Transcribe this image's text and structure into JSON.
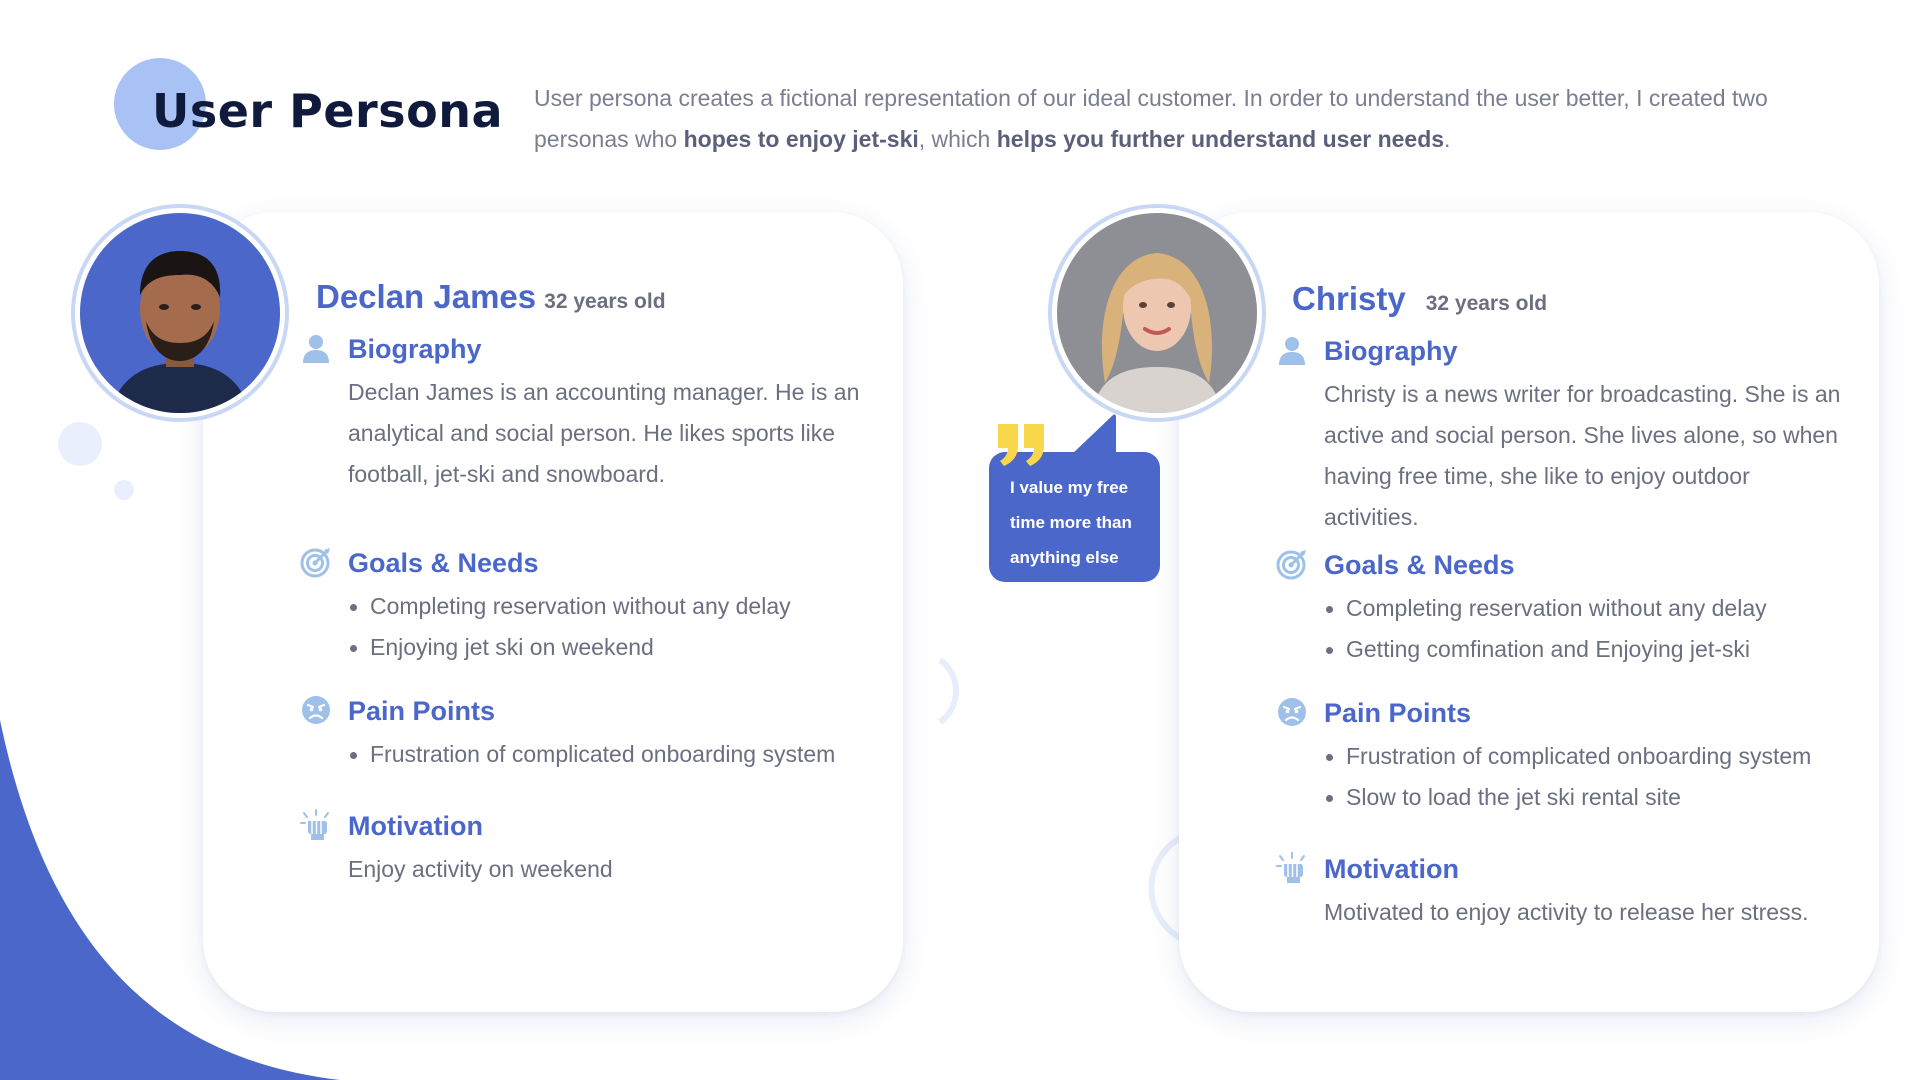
{
  "header": {
    "title": "User Persona",
    "intro_1": "User persona creates a fictional representation of our ideal customer. In order to understand the user better, I created two personas who ",
    "intro_bold_1": "hopes to enjoy jet-ski",
    "intro_2": ", which ",
    "intro_bold_2": "helps you further understand user needs",
    "intro_3": "."
  },
  "personas": [
    {
      "name": "Declan James",
      "age": "32 years old",
      "biography_title": "Biography",
      "biography": "Declan James is an accounting manager. He is an analytical and social person. He likes sports like football, jet-ski and snowboard.",
      "goals_title": "Goals & Needs",
      "goals": [
        "Completing reservation without any delay",
        "Enjoying jet ski on weekend"
      ],
      "pain_title": "Pain Points",
      "pain": [
        "Frustration of complicated onboarding system"
      ],
      "motivation_title": "Motivation",
      "motivation": "Enjoy activity on weekend"
    },
    {
      "name": "Christy",
      "age": "32 years old",
      "biography_title": "Biography",
      "biography": "Christy is a news writer for broadcasting. She is an active and social person. She lives alone, so when having free time, she like to enjoy outdoor activities.",
      "goals_title": "Goals & Needs",
      "goals": [
        "Completing reservation without any delay",
        "Getting comfination and Enjoying jet-ski"
      ],
      "pain_title": "Pain Points",
      "pain": [
        "Frustration of complicated onboarding system",
        "Slow to load the jet ski rental site"
      ],
      "motivation_title": "Motivation",
      "motivation": "Motivated to enjoy activity to release her stress."
    }
  ],
  "quote": {
    "line_1": "I value my free",
    "line_2": "time more than",
    "line_3": "anything else"
  },
  "colors": {
    "accent": "#4a67c9",
    "title_dot": "#a9c2f5",
    "title": "#0f1a3c",
    "body_text": "#6b6f80",
    "icon": "#9fc0e8",
    "quote_mark": "#f8d84a"
  },
  "icons": {
    "biography": "user-icon",
    "goals": "target-icon",
    "pain": "angry-face-icon",
    "motivation": "fist-icon",
    "quote": "quote-icon"
  }
}
